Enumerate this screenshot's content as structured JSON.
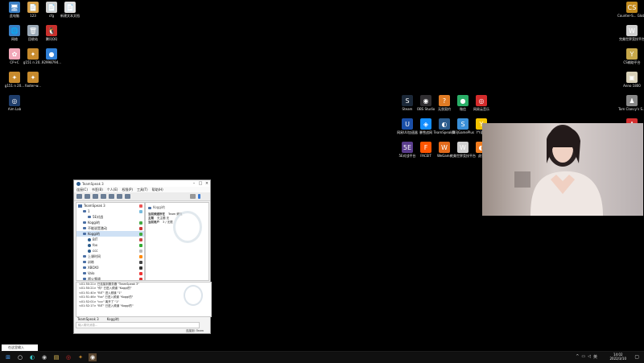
{
  "desktop_left": [
    {
      "label": "此电脑",
      "glyph": "🖥",
      "color": "#3b7fc4",
      "col": 0,
      "row": 0
    },
    {
      "label": "123",
      "glyph": "📄",
      "color": "#d9a24a",
      "col": 1,
      "row": 0
    },
    {
      "label": "cfg",
      "glyph": "📄",
      "color": "#cfcfcf",
      "col": 2,
      "row": 0
    },
    {
      "label": "新建文本文档",
      "glyph": "📄",
      "color": "#e0e0e0",
      "col": 3,
      "row": 0
    },
    {
      "label": "网络",
      "glyph": "🌐",
      "color": "#3b7fc4",
      "col": 0,
      "row": 1
    },
    {
      "label": "回收站",
      "glyph": "🗑",
      "color": "#9aa8b5",
      "col": 1,
      "row": 1
    },
    {
      "label": "腾讯QQ",
      "glyph": "🐧",
      "color": "#c9302c",
      "col": 2,
      "row": 1
    },
    {
      "label": "CP+C",
      "glyph": "✿",
      "color": "#f2a7b8",
      "col": 0,
      "row": 2
    },
    {
      "label": "g151 n 20...",
      "glyph": "✦",
      "color": "#c78a2d",
      "col": 1,
      "row": 2
    },
    {
      "label": "92998794...",
      "glyph": "●",
      "color": "#2f7fd6",
      "col": 2,
      "row": 2
    },
    {
      "label": "g151 n 20...",
      "glyph": "✦",
      "color": "#c78a2d",
      "col": 0,
      "row": 3
    },
    {
      "label": "footer-w...",
      "glyph": "✦",
      "color": "#c78a2d",
      "col": 1,
      "row": 3
    },
    {
      "label": "Aim Lab",
      "glyph": "◎",
      "color": "#1e3d6b",
      "col": 0,
      "row": 4
    }
  ],
  "desktop_right": [
    {
      "label": "Counter-S... Global Offi...",
      "glyph": "CS",
      "color": "#c28b1f",
      "row": 0
    },
    {
      "label": "完美世界竞技平台",
      "glyph": "W",
      "color": "#cfcfcf",
      "row": 1
    },
    {
      "label": "CS辅助平台",
      "glyph": "Y",
      "color": "#c7a84a",
      "row": 2
    },
    {
      "label": "Anno 1800",
      "glyph": "▣",
      "color": "#d8d0b8",
      "row": 3
    },
    {
      "label": "Tom Clancy's S...",
      "glyph": "♟",
      "color": "#888",
      "row": 4
    },
    {
      "label": "",
      "glyph": "A",
      "color": "#d32f2f",
      "row": 5
    }
  ],
  "desktop_mid": [
    {
      "label": "Steam",
      "glyph": "S",
      "color": "#1b2838",
      "col": 0,
      "row": 0
    },
    {
      "label": "OBS Studio",
      "glyph": "◉",
      "color": "#302e31",
      "col": 1,
      "row": 0
    },
    {
      "label": "无畏契约",
      "glyph": "?",
      "color": "#e07b24",
      "col": 2,
      "row": 0
    },
    {
      "label": "微信",
      "glyph": "●",
      "color": "#2aae67",
      "col": 3,
      "row": 0
    },
    {
      "label": "网易云音乐",
      "glyph": "◎",
      "color": "#d42b2b",
      "col": 4,
      "row": 0
    },
    {
      "label": "网易UU加速器",
      "glyph": "U",
      "color": "#1a4fa8",
      "col": 0,
      "row": 1
    },
    {
      "label": "暴雪战网",
      "glyph": "◈",
      "color": "#148eff",
      "col": 1,
      "row": 1
    },
    {
      "label": "TeamSpeak 3",
      "glyph": "◐",
      "color": "#2b5b8c",
      "col": 2,
      "row": 1
    },
    {
      "label": "腾讯GamePlus",
      "glyph": "S",
      "color": "#3a8fd8",
      "col": 3,
      "row": 1
    },
    {
      "label": "YY语音",
      "glyph": "Y",
      "color": "#f5c400",
      "col": 4,
      "row": 1
    },
    {
      "label": "5E对战平台",
      "glyph": "5E",
      "color": "#5a3d8c",
      "col": 0,
      "row": 2
    },
    {
      "label": "FACEIT",
      "glyph": "F",
      "color": "#ff5500",
      "col": 1,
      "row": 2
    },
    {
      "label": "WeGame",
      "glyph": "W",
      "color": "#e26a1b",
      "col": 2,
      "row": 2
    },
    {
      "label": "完美世界竞技平台",
      "glyph": "W",
      "color": "#d0d0d0",
      "col": 3,
      "row": 2
    },
    {
      "label": "虎牙",
      "glyph": "◐",
      "color": "#f07b1e",
      "col": 4,
      "row": 2
    }
  ],
  "teamspeak": {
    "title": "TeamSpeak 3",
    "menu": [
      "连接(C)",
      "书签(B)",
      "个人(E)",
      "权限(P)",
      "工具(T)",
      "帮助(H)"
    ],
    "tree": [
      {
        "label": "TeamSpeak 3",
        "indent": 0,
        "type": "server",
        "flag": "#e55"
      },
      {
        "label": "1",
        "indent": 1,
        "type": "chan",
        "flag": "#7bd"
      },
      {
        "label": "5E对战",
        "indent": 2,
        "type": "chan",
        "flag": ""
      },
      {
        "label": "Koggi的",
        "indent": 1,
        "type": "chan",
        "flag": "#4a4"
      },
      {
        "label": "不能说是激动",
        "indent": 1,
        "type": "chan",
        "flag": "#c33"
      },
      {
        "label": "Koggi的",
        "indent": 1,
        "type": "chan",
        "flag": "#4a4",
        "sel": true
      },
      {
        "label": "BIT",
        "indent": 2,
        "type": "user",
        "flag": "#c44"
      },
      {
        "label": "fox",
        "indent": 2,
        "type": "user",
        "flag": "#3a3"
      },
      {
        "label": "ccc",
        "indent": 2,
        "type": "user",
        "flag": "#bbb"
      },
      {
        "label": "上课时间",
        "indent": 1,
        "type": "chan",
        "flag": "#f80"
      },
      {
        "label": "训练",
        "indent": 1,
        "type": "chan",
        "flag": "#444"
      },
      {
        "label": "XBOX0",
        "indent": 1,
        "type": "chan",
        "flag": "#333"
      },
      {
        "label": "Valo",
        "indent": 1,
        "type": "chan",
        "flag": "#e33"
      },
      {
        "label": "超火频道",
        "indent": 1,
        "type": "chan",
        "flag": "#d33"
      }
    ],
    "info": {
      "head": "Koggi的",
      "rows": [
        {
          "k": "当前频道所在",
          "v": "Team 频道"
        },
        {
          "k": "主题",
          "v": "无主题 无"
        },
        {
          "k": "当前用户",
          "v": "3 / 无限"
        }
      ]
    },
    "log": [
      "<01:50:21> 已连接到服务器 \"TeamSpeak 3\"",
      "<01:50:21> \"你\" 已进入频道 \"Koggi的\"",
      "<01:51:40> \"BIT\" 进入频道 \"1\"",
      "<01:51:46> \"fox\" 已进入频道 \"Koggi的\"",
      "<01:52:01> \"ccc\" 离开了 \"1\"",
      "<01:52:17> \"BIT\" 已进入频道 \"Koggi的\""
    ],
    "tabs": [
      "TeamSpeak 3",
      "Koggi的"
    ],
    "input_placeholder": "输入聊天消息...",
    "status": "连接到: Team"
  },
  "taskbar": {
    "search_label": "在这里输入",
    "time": "14:02",
    "date": "2022/3/10",
    "lang": "英"
  }
}
